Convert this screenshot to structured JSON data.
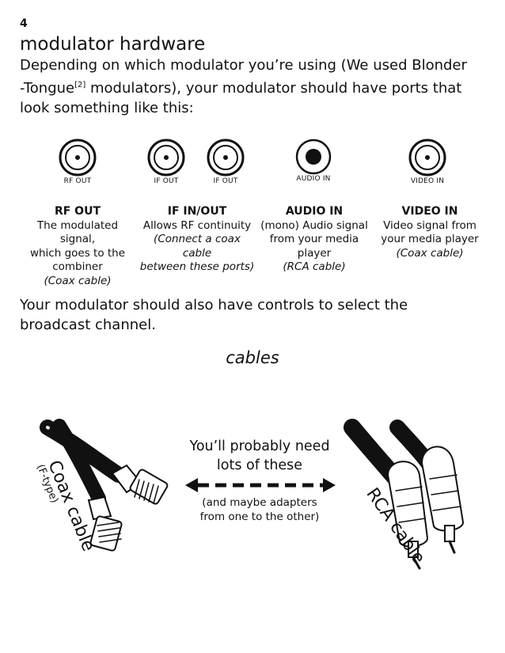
{
  "page_number": "4",
  "title": "modulator hardware",
  "intro": {
    "line1": "Depending on which modulator you’re using (We used Blonder",
    "line2_a": "-Tongue",
    "line2_sup": "[2]",
    "line2_b": " modulators), your modulator should have ports that",
    "line3": "look something like this:"
  },
  "ports": {
    "rf_out": "RF OUT",
    "if_out_1": "IF OUT",
    "if_out_2": "IF OUT",
    "audio_in": "AUDIO IN",
    "video_in": "VIDEO IN"
  },
  "descriptions": [
    {
      "heading": "RF OUT",
      "lines": [
        "The modulated signal,",
        "which goes to the",
        "combiner"
      ],
      "note": "(Coax cable)"
    },
    {
      "heading": "IF IN/OUT",
      "lines": [
        "Allows RF continuity"
      ],
      "note_lines": [
        "(Connect a coax cable",
        "between these ports)"
      ]
    },
    {
      "heading": "AUDIO IN",
      "lines": [
        "(mono) Audio signal",
        "from your media",
        "player"
      ],
      "note": "(RCA cable)"
    },
    {
      "heading": "VIDEO IN",
      "lines": [
        "Video signal from",
        "your media player"
      ],
      "note": "(Coax cable)"
    }
  ],
  "controls": {
    "line1": "Your modulator should also have controls to select the",
    "line2": "broadcast channel."
  },
  "cables_heading": "cables",
  "cables": {
    "need_line1": "You’ll probably need",
    "need_line2": "lots of these",
    "adapt_line1": "(and maybe adapters",
    "adapt_line2": "from one to the other)",
    "coax_label": "Coax cable",
    "coax_sub": "(F-type)",
    "rca_label": "RCA cable"
  }
}
